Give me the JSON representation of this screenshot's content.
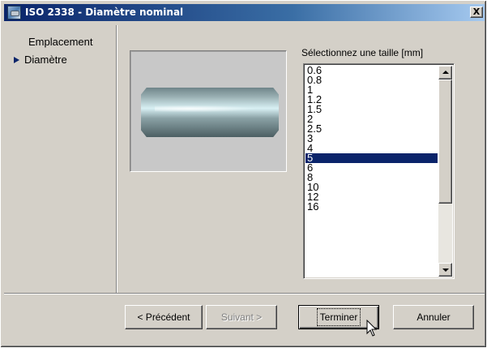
{
  "window": {
    "title": "ISO 2338 - Diamètre nominal",
    "close_label": "X"
  },
  "nav": {
    "items": [
      {
        "label": "Emplacement",
        "active": false
      },
      {
        "label": "Diamètre",
        "active": true
      }
    ]
  },
  "preview": {
    "icon": "cylindrical-pin-image"
  },
  "size_list": {
    "label": "Sélectionnez une taille [mm]",
    "items": [
      "0.6",
      "0.8",
      "1",
      "1.2",
      "1.5",
      "2",
      "2.5",
      "3",
      "4",
      "5",
      "6",
      "8",
      "10",
      "12",
      "16"
    ],
    "selected": "5"
  },
  "buttons": {
    "previous": "< Précédent",
    "next": "Suivant >",
    "finish": "Terminer",
    "cancel": "Annuler"
  },
  "colors": {
    "title_bar": "#0a246a",
    "selection": "#0a246a",
    "face": "#d4d0c8"
  }
}
